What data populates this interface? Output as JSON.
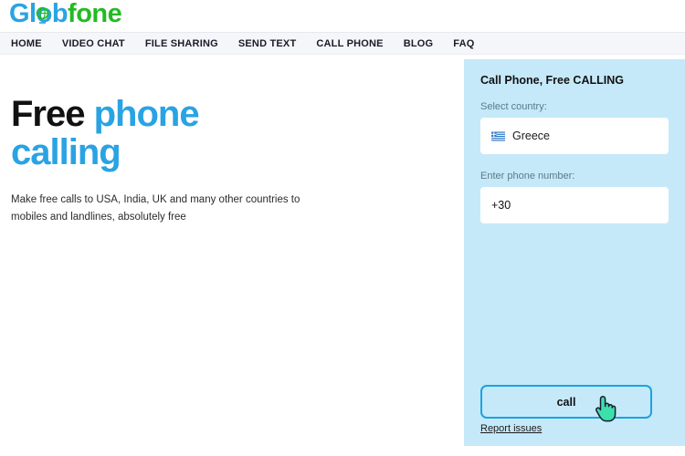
{
  "brand": {
    "logo_part1": "Glob",
    "logo_part2": "fone",
    "globe_icon": "globe-icon",
    "color_blue": "#29a3e3",
    "color_green": "#22bb22"
  },
  "nav": {
    "items": [
      {
        "label": "HOME"
      },
      {
        "label": "VIDEO CHAT"
      },
      {
        "label": "FILE SHARING"
      },
      {
        "label": "SEND TEXT"
      },
      {
        "label": "CALL PHONE"
      },
      {
        "label": "BLOG"
      },
      {
        "label": "FAQ"
      }
    ]
  },
  "hero": {
    "title_dark": "Free ",
    "title_blue_line1": "phone",
    "title_blue_line2": "calling",
    "subtitle": "Make free calls to USA, India, UK and many other countries to mobiles and landlines, absolutely free"
  },
  "call_panel": {
    "title": "Call Phone, Free CALLING",
    "country_label": "Select country:",
    "country_value": "Greece",
    "country_flag_icon": "greece-flag-icon",
    "phone_label": "Enter phone number:",
    "phone_value": "+30",
    "phone_placeholder": "Enter phone number",
    "call_button_label": "call",
    "report_link_label": "Report issues",
    "background_color": "#c5e9f9",
    "accent_color": "#1ba3e0"
  },
  "cursor": {
    "icon": "pointing-hand-cursor",
    "color": "#3ce0ad"
  }
}
